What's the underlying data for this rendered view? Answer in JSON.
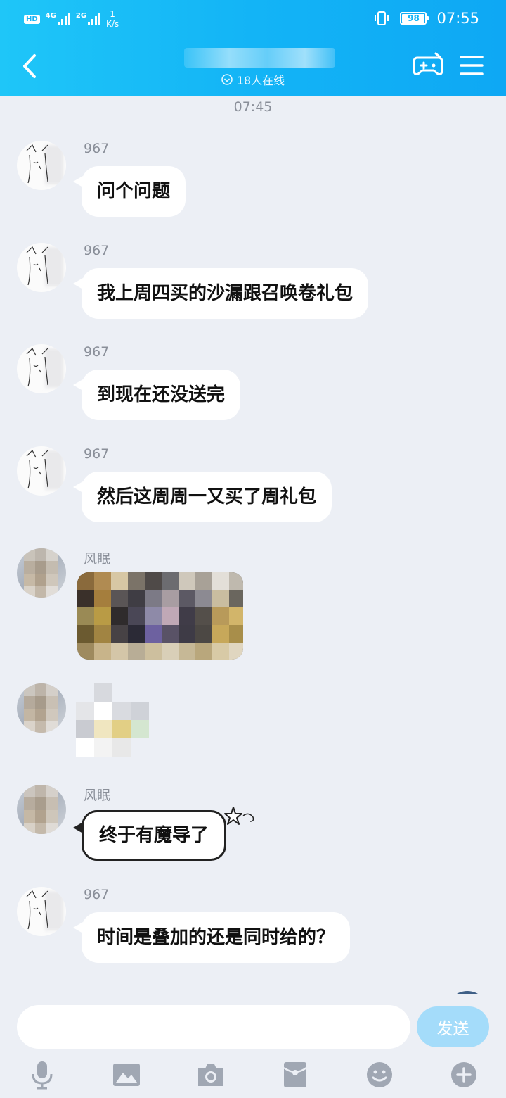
{
  "status_bar": {
    "hd": "HD",
    "network_1": "4G",
    "network_2": "2G",
    "speed_value": "1",
    "speed_unit": "K/s",
    "battery": "98",
    "battery_level": 0.98,
    "time": "07:55"
  },
  "header": {
    "online_text": "18人在线"
  },
  "chat": {
    "timestamp": "07:45",
    "messages": [
      {
        "sender": "967",
        "text": "问个问题"
      },
      {
        "sender": "967",
        "text": "我上周四买的沙漏跟召唤卷礼包"
      },
      {
        "sender": "967",
        "text": "到现在还没送完"
      },
      {
        "sender": "967",
        "text": "然后这周周一又买了周礼包"
      },
      {
        "sender": "风眠"
      },
      {},
      {
        "sender": "风眠",
        "text": "终于有魔导了"
      },
      {
        "sender": "967",
        "text": "时间是叠加的还是同时给的？"
      }
    ]
  },
  "input": {
    "send_label": "发送"
  },
  "toolbar": {
    "icons": [
      "microphone-icon",
      "image-icon",
      "camera-icon",
      "red-packet-icon",
      "emoji-icon",
      "plus-icon"
    ]
  },
  "colors": {
    "header": "#13b4f6",
    "background": "#eceff5",
    "send_button": "#a4dcfa",
    "toolbar_icon": "#a0a7b3"
  }
}
